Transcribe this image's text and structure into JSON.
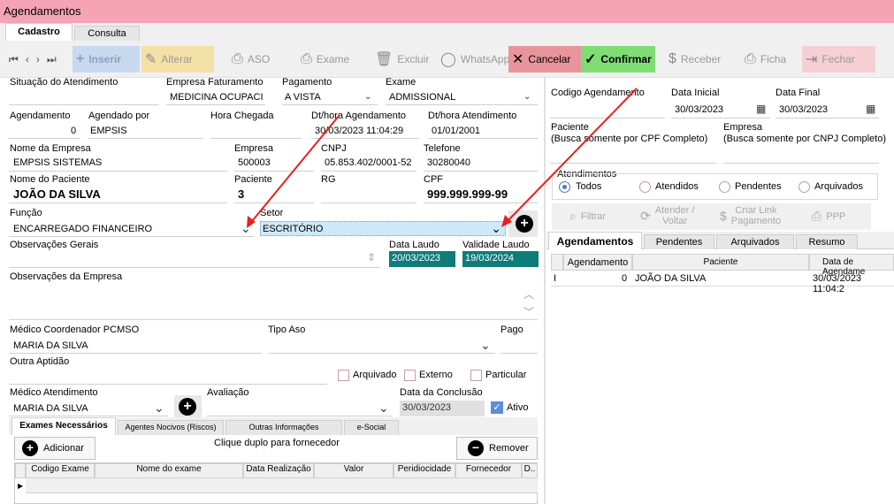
{
  "window": {
    "title": "Agendamentos"
  },
  "tabs": {
    "cadastro": "Cadastro",
    "consulta": "Consulta"
  },
  "toolbar": {
    "inserir": "Inserir",
    "alterar": "Alterar",
    "aso": "ASO",
    "exame": "Exame",
    "excluir": "Excluir",
    "whatsapp": "WhatsApp",
    "cancelar": "Cancelar",
    "confirmar": "Confirmar",
    "receber": "Receber",
    "ficha": "Ficha",
    "fechar": "Fechar"
  },
  "form": {
    "situacao_label": "Situação do Atendimento",
    "empresa_fat_label": "Empresa Faturamento",
    "empresa_fat_value": "MEDICINA OCUPACIC",
    "pagamento_label": "Pagamento",
    "pagamento_value": "A VISTA",
    "exame_label": "Exame",
    "exame_value": "ADMISSIONAL",
    "agendamento_label": "Agendamento",
    "agendamento_value": "0",
    "agendado_por_label": "Agendado por",
    "agendado_por_value": "EMPSIS",
    "hora_chegada_label": "Hora Chegada",
    "dthora_agend_label": "Dt/hora Agendamento",
    "dthora_agend_value": "30/03/2023 11:04:29",
    "dthora_atend_label": "Dt/hora Atendimento",
    "dthora_atend_value": "01/01/2001",
    "nome_empresa_label": "Nome da Empresa",
    "nome_empresa_value": "EMPSIS SISTEMAS",
    "empresa_label": "Empresa",
    "empresa_value": "500003",
    "cnpj_label": "CNPJ",
    "cnpj_value": "05.853.402/0001-52",
    "telefone_label": "Telefone",
    "telefone_value": "30280040",
    "nome_paciente_label": "Nome do Paciente",
    "nome_paciente_value": "JOÃO DA SILVA",
    "paciente_label": "Paciente",
    "paciente_value": "3",
    "rg_label": "RG",
    "cpf_label": "CPF",
    "cpf_value": "999.999.999-99",
    "funcao_label": "Função",
    "funcao_value": "ENCARREGADO FINANCEIRO",
    "setor_label": "Setor",
    "setor_value": "ESCRITÓRIO",
    "obs_gerais_label": "Observações Gerais",
    "data_laudo_label": "Data Laudo",
    "data_laudo_value": "20/03/2023",
    "validade_laudo_label": "Validade Laudo",
    "validade_laudo_value": "19/03/2024",
    "obs_empresa_label": "Observações da Empresa",
    "medico_coord_label": "Médico Coordenador PCMSO",
    "medico_coord_value": "MARIA DA SILVA",
    "tipo_aso_label": "Tipo Aso",
    "pago_label": "Pago",
    "outra_aptidao_label": "Outra Aptidão",
    "arquivado_label": "Arquivado",
    "externo_label": "Externo",
    "particular_label": "Particular",
    "medico_atend_label": "Médico Atendimento",
    "medico_atend_value": "MARIA DA SILVA",
    "avaliacao_label": "Avaliação",
    "data_conclusao_label": "Data da Conclusão",
    "data_conclusao_value": "30/03/2023",
    "ativo_label": "Ativo"
  },
  "subtabs": {
    "exames": "Exames Necessários",
    "agentes": "Agentes Nocivos (Riscos)",
    "outras": "Outras Informações",
    "esocial": "e-Social"
  },
  "exames": {
    "adicionar": "Adicionar",
    "hint": "Clique duplo para fornecedor",
    "remover": "Remover",
    "columns": [
      "Codigo Exame",
      "Nome do exame",
      "Data Realização",
      "Valor",
      "Peridiocidade",
      "Fornecedor",
      "D.."
    ]
  },
  "right": {
    "codigo_agend_label": "Codigo Agendamento",
    "data_inicial_label": "Data Inicial",
    "data_inicial_value": "30/03/2023",
    "data_final_label": "Data Final",
    "data_final_value": "30/03/2023",
    "paciente_label": "Paciente",
    "paciente_hint": "(Busca somente por CPF Completo)",
    "empresa_label": "Empresa",
    "empresa_hint": "(Busca somente por CNPJ Completo)",
    "atendimentos_label": "Atendimentos",
    "radio_todos": "Todos",
    "radio_atendidos": "Atendidos",
    "radio_pendentes": "Pendentes",
    "radio_arquivados": "Arquivados",
    "filtrar": "Filtrar",
    "atender_l1": "Atender /",
    "atender_l2": "Voltar",
    "criar_l1": "Criar Link",
    "criar_l2": "Pagamento",
    "ppp": "PPP",
    "tab_agend": "Agendamentos",
    "tab_pend": "Pendentes",
    "tab_arq": "Arquivados",
    "tab_resumo": "Resumo",
    "grid_cols": [
      "Agendamento",
      "Paciente",
      "Data de Agendame"
    ],
    "grid_row": {
      "indicator": "I",
      "agendamento": "0",
      "paciente": "JOÃO DA SILVA",
      "data": "30/03/2023 11:04:2"
    }
  },
  "colors": {
    "title_bar": "#f4a4b4",
    "cancel_bg": "#e8949c",
    "confirm_bg": "#7ede74",
    "alterar_bg": "#f3e1a8",
    "inserir_bg": "#c8d9ef",
    "setor_bg": "#cfe8f8",
    "laudo_bg": "#0e7c7b",
    "arrow": "#e8201e"
  }
}
